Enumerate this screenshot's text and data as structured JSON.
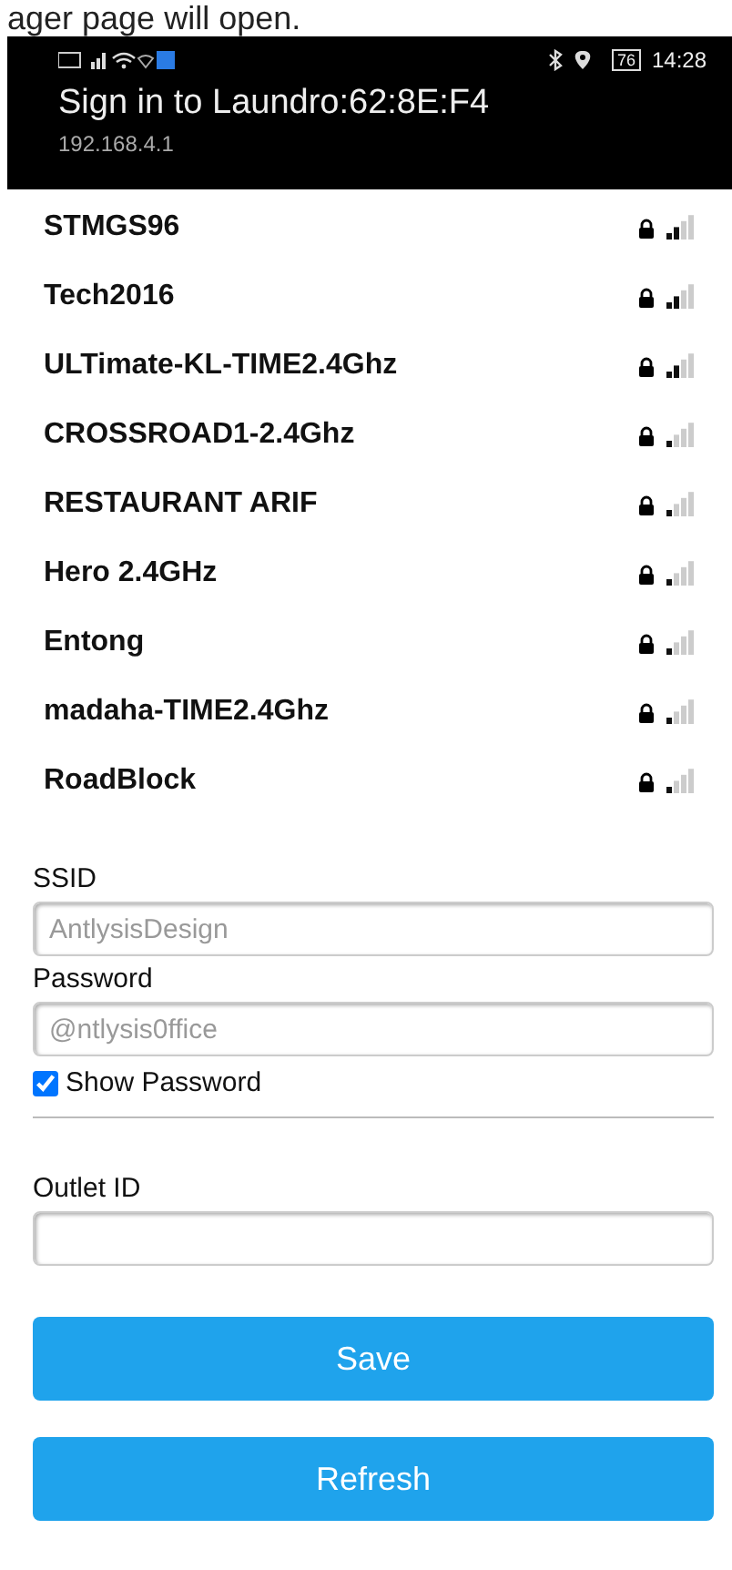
{
  "background_text": "ager page will open.",
  "status_bar": {
    "battery": "76",
    "time": "14:28"
  },
  "header": {
    "title": "Sign in to Laundro:62:8E:F4",
    "address": "192.168.4.1"
  },
  "networks": [
    {
      "name": "STMGS96",
      "kind": "fair"
    },
    {
      "name": "Tech2016",
      "kind": "fair"
    },
    {
      "name": "ULTimate-KL-TIME2.4Ghz",
      "kind": "fair"
    },
    {
      "name": "CROSSROAD1-2.4Ghz",
      "kind": "weak"
    },
    {
      "name": "RESTAURANT ARIF",
      "kind": "weak"
    },
    {
      "name": "Hero 2.4GHz",
      "kind": "weak"
    },
    {
      "name": "Entong",
      "kind": "weak"
    },
    {
      "name": "madaha-TIME2.4Ghz",
      "kind": "weak"
    },
    {
      "name": "RoadBlock",
      "kind": "weak"
    }
  ],
  "ssid": {
    "label": "SSID",
    "placeholder": "AntlysisDesign"
  },
  "password": {
    "label": "Password",
    "placeholder": "@ntlysis0ffice"
  },
  "show_password": {
    "label": "Show Password",
    "checked": true
  },
  "outlet_id": {
    "label": "Outlet ID"
  },
  "buttons": [
    "Save",
    "Refresh"
  ]
}
